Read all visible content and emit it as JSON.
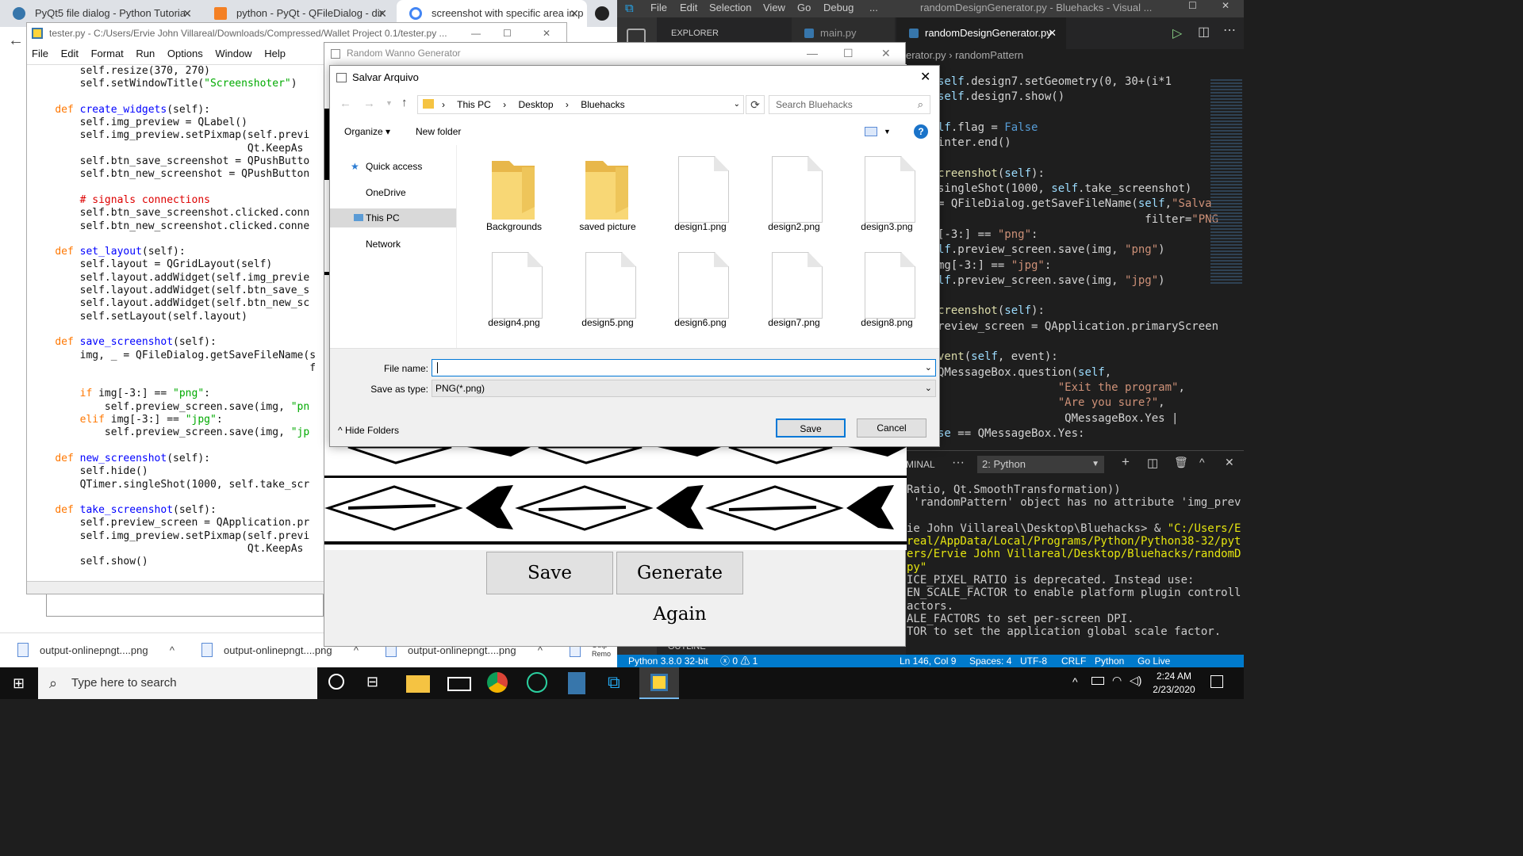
{
  "browser": {
    "tabs": [
      {
        "label": "PyQt5 file dialog - Python Tutoria"
      },
      {
        "label": "python - PyQt - QFileDialog - dir"
      },
      {
        "label": "screenshot with specific area in p"
      }
    ],
    "downloads": [
      {
        "name": "output-onlinepngt....png"
      },
      {
        "name": "output-onlinepngt....png"
      },
      {
        "name": "output-onlinepngt....png"
      },
      {
        "name": "Outp Remo"
      }
    ]
  },
  "idle": {
    "title": "tester.py - C:/Users/Ervie John Villareal/Downloads/Compressed/Wallet Project 0.1/tester.py ...",
    "menu": [
      "File",
      "Edit",
      "Format",
      "Run",
      "Options",
      "Window",
      "Help"
    ]
  },
  "wanno": {
    "title": "Random Wanno Generator",
    "save_label": "Save",
    "generate_label": "Generate Again"
  },
  "dialog": {
    "title": "Salvar Arquivo",
    "path": [
      "This PC",
      "Desktop",
      "Bluehacks"
    ],
    "search_placeholder": "Search Bluehacks",
    "organize": "Organize",
    "new_folder": "New folder",
    "nav": [
      "Quick access",
      "OneDrive",
      "This PC",
      "Network"
    ],
    "files": [
      "Backgrounds",
      "saved picture",
      "design1.png",
      "design2.png",
      "design3.png",
      "design4.png",
      "design5.png",
      "design6.png",
      "design7.png",
      "design8.png"
    ],
    "file_name_label": "File name:",
    "file_name_value": "",
    "save_type_label": "Save as type:",
    "save_type_value": "PNG(*.png)",
    "hide_folders": "Hide Folders",
    "save": "Save",
    "cancel": "Cancel"
  },
  "vscode": {
    "menu": [
      "File",
      "Edit",
      "Selection",
      "View",
      "Go",
      "Debug",
      "..."
    ],
    "title": "randomDesignGenerator.py - Bluehacks - Visual ...",
    "explorer": "EXPLORER",
    "tabs": [
      "main.py",
      "randomDesignGenerator.py"
    ],
    "breadcrumb": [
      "erator.py",
      "randomPattern"
    ],
    "terminal_label": "MINAL",
    "terminal_select": "2: Python",
    "status": [
      "Python 3.8.0 32-bit",
      "ⓧ 0 ⚠ 1",
      "Ln 146, Col 9",
      "Spaces: 4",
      "UTF-8",
      "CRLF",
      "Python",
      "Go Live"
    ],
    "outline": "OUTLINE"
  },
  "taskbar": {
    "search": "Type here to search",
    "time": "2:24 AM",
    "date": "2/23/2020"
  }
}
